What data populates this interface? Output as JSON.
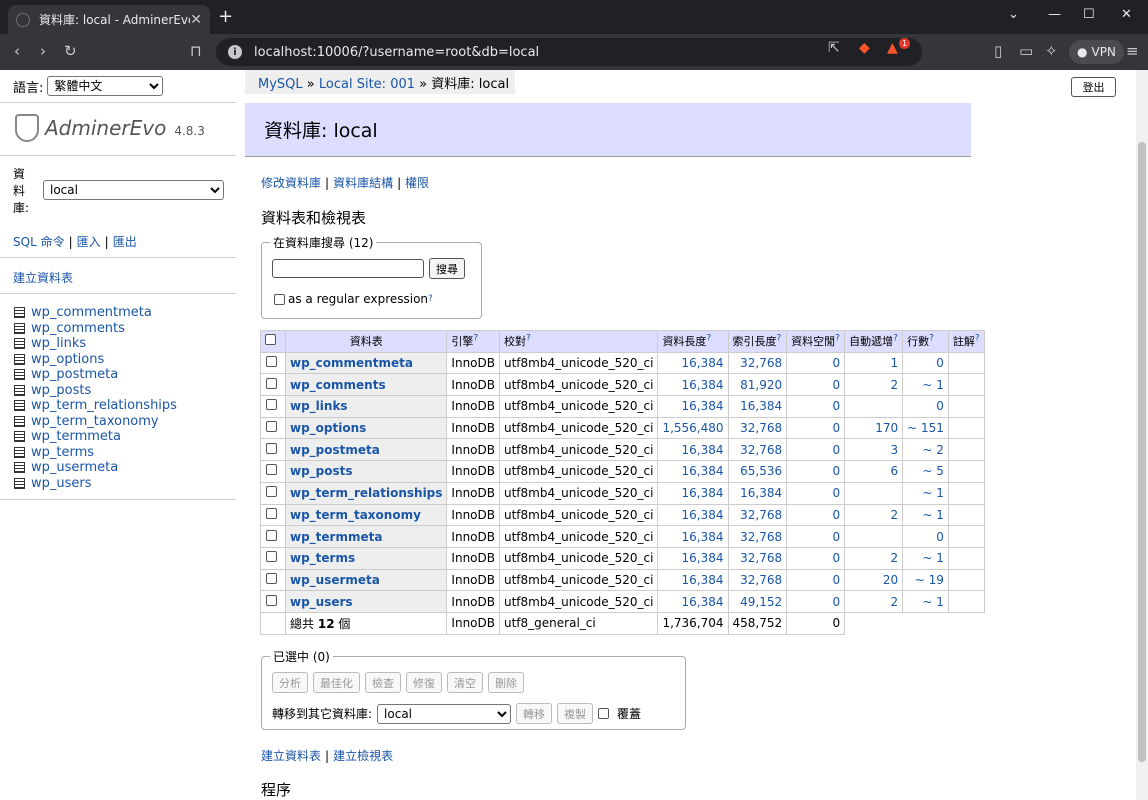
{
  "browser": {
    "tab_title": "資料庫: local - AdminerEvo",
    "url": "localhost:10006/?username=root&db=local",
    "vpn_label": "VPN",
    "notification_count": "1"
  },
  "sidebar": {
    "language_label": "語言:",
    "language_value": "繁體中文",
    "app_name": "AdminerEvo",
    "version": "4.8.3",
    "db_label": "資料庫:",
    "db_value": "local",
    "links": [
      "SQL 命令",
      "匯入",
      "匯出"
    ],
    "create_db": "建立資料表",
    "tables": [
      "wp_commentmeta",
      "wp_comments",
      "wp_links",
      "wp_options",
      "wp_postmeta",
      "wp_posts",
      "wp_term_relationships",
      "wp_term_taxonomy",
      "wp_termmeta",
      "wp_terms",
      "wp_usermeta",
      "wp_users"
    ]
  },
  "breadcrumb": {
    "mysql": "MySQL",
    "site": "Local Site: 001",
    "current": "資料庫: local",
    "sep": "»"
  },
  "logout_label": "登出",
  "header_title": "資料庫: local",
  "main_links": [
    "修改資料庫",
    "資料庫結構",
    "權限"
  ],
  "section_title": "資料表和檢視表",
  "search": {
    "legend": "在資料庫搜尋 (12)",
    "button": "搜尋",
    "regex_label": "as a regular expression",
    "help": "?"
  },
  "table": {
    "headers": [
      "資料表",
      "引擎",
      "校對",
      "資料長度",
      "索引長度",
      "資料空閒",
      "自動遞增",
      "行數",
      "註解"
    ],
    "rows": [
      {
        "name": "wp_commentmeta",
        "engine": "InnoDB",
        "collation": "utf8mb4_unicode_520_ci",
        "data": "16,384",
        "index": "32,768",
        "free": "0",
        "auto": "1",
        "rows": "0"
      },
      {
        "name": "wp_comments",
        "engine": "InnoDB",
        "collation": "utf8mb4_unicode_520_ci",
        "data": "16,384",
        "index": "81,920",
        "free": "0",
        "auto": "2",
        "rows": "~ 1"
      },
      {
        "name": "wp_links",
        "engine": "InnoDB",
        "collation": "utf8mb4_unicode_520_ci",
        "data": "16,384",
        "index": "16,384",
        "free": "0",
        "auto": "",
        "rows": "0"
      },
      {
        "name": "wp_options",
        "engine": "InnoDB",
        "collation": "utf8mb4_unicode_520_ci",
        "data": "1,556,480",
        "index": "32,768",
        "free": "0",
        "auto": "170",
        "rows": "~ 151"
      },
      {
        "name": "wp_postmeta",
        "engine": "InnoDB",
        "collation": "utf8mb4_unicode_520_ci",
        "data": "16,384",
        "index": "32,768",
        "free": "0",
        "auto": "3",
        "rows": "~ 2"
      },
      {
        "name": "wp_posts",
        "engine": "InnoDB",
        "collation": "utf8mb4_unicode_520_ci",
        "data": "16,384",
        "index": "65,536",
        "free": "0",
        "auto": "6",
        "rows": "~ 5"
      },
      {
        "name": "wp_term_relationships",
        "engine": "InnoDB",
        "collation": "utf8mb4_unicode_520_ci",
        "data": "16,384",
        "index": "16,384",
        "free": "0",
        "auto": "",
        "rows": "~ 1"
      },
      {
        "name": "wp_term_taxonomy",
        "engine": "InnoDB",
        "collation": "utf8mb4_unicode_520_ci",
        "data": "16,384",
        "index": "32,768",
        "free": "0",
        "auto": "2",
        "rows": "~ 1"
      },
      {
        "name": "wp_termmeta",
        "engine": "InnoDB",
        "collation": "utf8mb4_unicode_520_ci",
        "data": "16,384",
        "index": "32,768",
        "free": "0",
        "auto": "",
        "rows": "0"
      },
      {
        "name": "wp_terms",
        "engine": "InnoDB",
        "collation": "utf8mb4_unicode_520_ci",
        "data": "16,384",
        "index": "32,768",
        "free": "0",
        "auto": "2",
        "rows": "~ 1"
      },
      {
        "name": "wp_usermeta",
        "engine": "InnoDB",
        "collation": "utf8mb4_unicode_520_ci",
        "data": "16,384",
        "index": "32,768",
        "free": "0",
        "auto": "20",
        "rows": "~ 19"
      },
      {
        "name": "wp_users",
        "engine": "InnoDB",
        "collation": "utf8mb4_unicode_520_ci",
        "data": "16,384",
        "index": "49,152",
        "free": "0",
        "auto": "2",
        "rows": "~ 1"
      }
    ],
    "footer": {
      "prefix": "總共",
      "count": "12",
      "suffix": "個",
      "engine": "InnoDB",
      "collation": "utf8_general_ci",
      "data": "1,736,704",
      "index": "458,752",
      "free": "0"
    }
  },
  "selected": {
    "legend": "已選中 (0)",
    "buttons": [
      "分析",
      "最佳化",
      "檢查",
      "修復",
      "清空",
      "刪除"
    ],
    "move_label": "轉移到其它資料庫:",
    "move_db": "local",
    "move_btn": "轉移",
    "copy_btn": "複製",
    "overwrite": "覆蓋"
  },
  "bottom_links": [
    "建立資料表",
    "建立檢視表"
  ],
  "procedures_title": "程序"
}
